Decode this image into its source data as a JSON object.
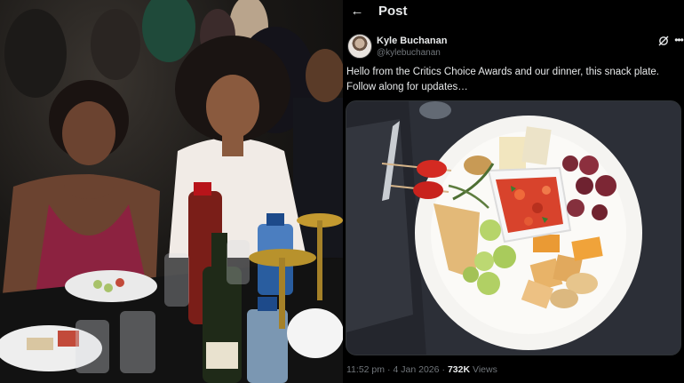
{
  "header": {
    "title": "Post",
    "back_icon": "arrow-left-icon"
  },
  "post": {
    "author": {
      "display_name": "Kyle Buchanan",
      "handle": "@kylebuchanan",
      "avatar_icon": "user-avatar"
    },
    "actions": {
      "grok_icon": "grok-icon",
      "more_icon": "more-horizontal-icon"
    },
    "text": "Hello from the Critics Choice Awards and our dinner, this snack plate. Follow along for updates…",
    "meta": {
      "time": "11:52 pm",
      "date": "4 Jan 2026",
      "views_count": "732K",
      "views_label": "Views"
    }
  },
  "colors": {
    "background": "#000000",
    "text_primary": "#e7e9ea",
    "text_secondary": "#71767b",
    "border": "#2f3336"
  }
}
